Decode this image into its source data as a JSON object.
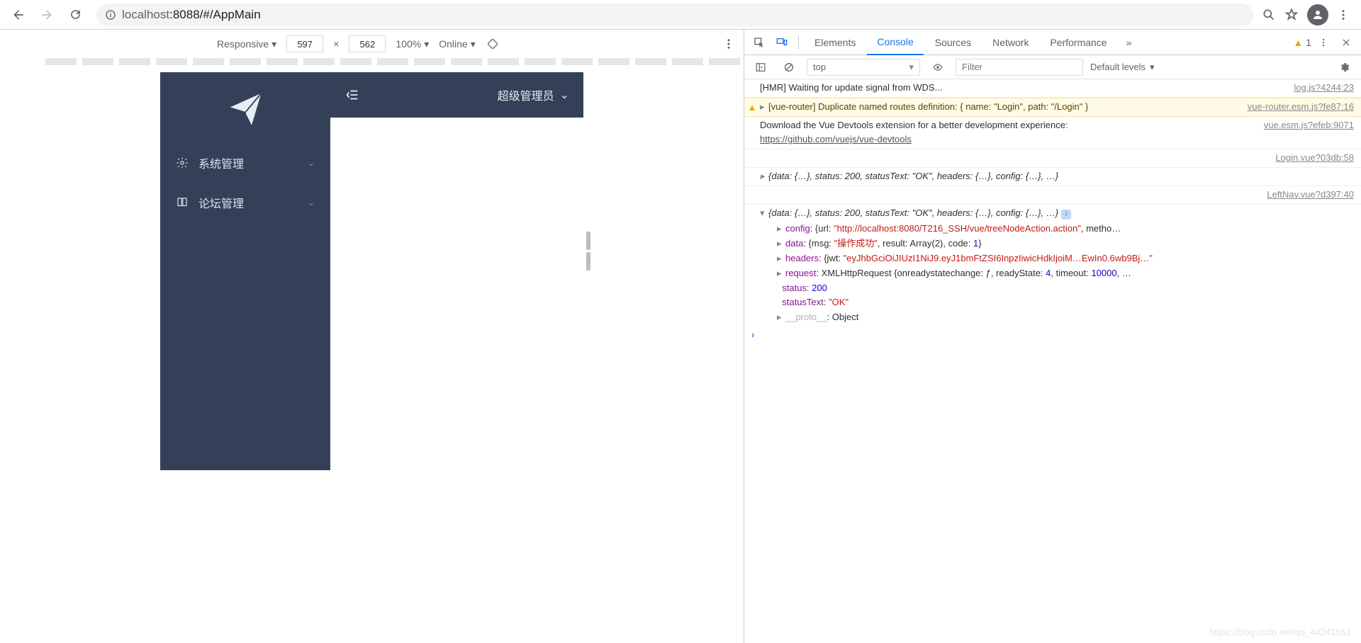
{
  "browser": {
    "url_host": "localhost",
    "url_rest": ":8088/#/AppMain"
  },
  "device_toolbar": {
    "mode": "Responsive",
    "width": "597",
    "height": "562",
    "zoom": "100%",
    "network": "Online"
  },
  "app": {
    "sidebar": {
      "items": [
        {
          "label": "系统管理"
        },
        {
          "label": "论坛管理"
        }
      ]
    },
    "header": {
      "user_label": "超级管理员"
    }
  },
  "devtools": {
    "tabs": [
      "Elements",
      "Console",
      "Sources",
      "Network",
      "Performance"
    ],
    "active_tab": "Console",
    "warning_count": "1",
    "toolbar": {
      "context": "top",
      "filter_placeholder": "Filter",
      "levels": "Default levels"
    },
    "logs": {
      "hmr": {
        "msg": "[HMR] Waiting for update signal from WDS...",
        "src": "log.js?4244:23"
      },
      "warn": {
        "prefix": "[vue-router] Duplicate named routes definition: { name: \"Login\", path: \"/Login\" }",
        "src": "vue-router.esm.js?fe87:16"
      },
      "devtools": {
        "line1": "Download the Vue Devtools extension for a better development experience:",
        "link": "https://github.com/vuejs/vue-devtools",
        "src": "vue.esm.js?efeb:9071"
      },
      "login_src": "Login.vue?03db:58",
      "login_obj": "{data: {…}, status: 200, statusText: \"OK\", headers: {…}, config: {…}, …}",
      "leftnav_src": "LeftNav.vue?d397:40",
      "leftnav_obj": "{data: {…}, status: 200, statusText: \"OK\", headers: {…}, config: {…}, …}",
      "config_url": "\"http://localhost:8080/T216_SSH/vue/treeNodeAction.action\"",
      "data_msg": "\"操作成功\"",
      "data_rest": ", result: Array(2), code: ",
      "data_code": "1",
      "headers_jwt": "\"eyJhbGciOiJIUzI1NiJ9.eyJ1bmFtZSI6InpzIiwicHdkIjoiM…EwIn0.6wb9Bj…\"",
      "request_rest": "XMLHttpRequest {onreadystatechange: ƒ, readyState: ",
      "request_ready": "4",
      "request_rest2": ", timeout: ",
      "request_timeout": "10000",
      "status_val": "200",
      "statusText_val": "\"OK\"",
      "proto": "__proto__",
      "proto_val": "Object"
    }
  },
  "watermark": "https://blog.csdn.net/qq_44241551"
}
